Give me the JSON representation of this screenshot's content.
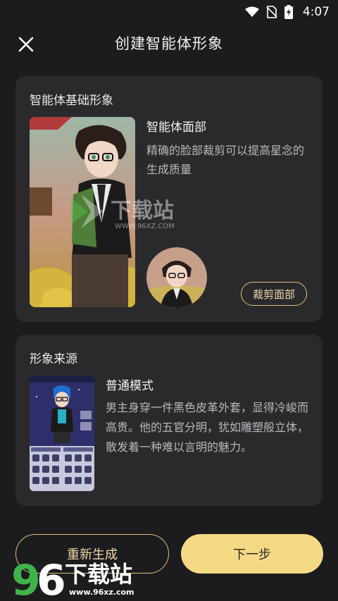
{
  "status_bar": {
    "time": "4:07",
    "icons": [
      "wifi-icon",
      "no-sim-icon",
      "battery-charging-icon"
    ]
  },
  "header": {
    "title": "创建智能体形象",
    "close_icon": "close-icon"
  },
  "base_section": {
    "title": "智能体基础形象",
    "face_label": "智能体面部",
    "face_description": "精确的脸部裁剪可以提高星念的生成质量",
    "crop_button": "裁剪面部"
  },
  "source_section": {
    "title": "形象来源",
    "mode_label": "普通模式",
    "mode_description": "男主身穿一件黑色皮革外套，显得冷峻而高贵。他的五官分明，犹如雕塑般立体，散发着一种难以言明的魅力。"
  },
  "actions": {
    "regenerate": "重新生成",
    "next": "下一步"
  },
  "watermarks": {
    "center_text": "下载站",
    "center_url": "WWW.96XZ.COM",
    "bottom_text": "下载站",
    "bottom_url": "www.96xz.com"
  },
  "colors": {
    "background": "#1c1c1e",
    "card": "#2a2a2d",
    "accent_gold": "#e2c07a",
    "primary_button": "#f6d985"
  }
}
